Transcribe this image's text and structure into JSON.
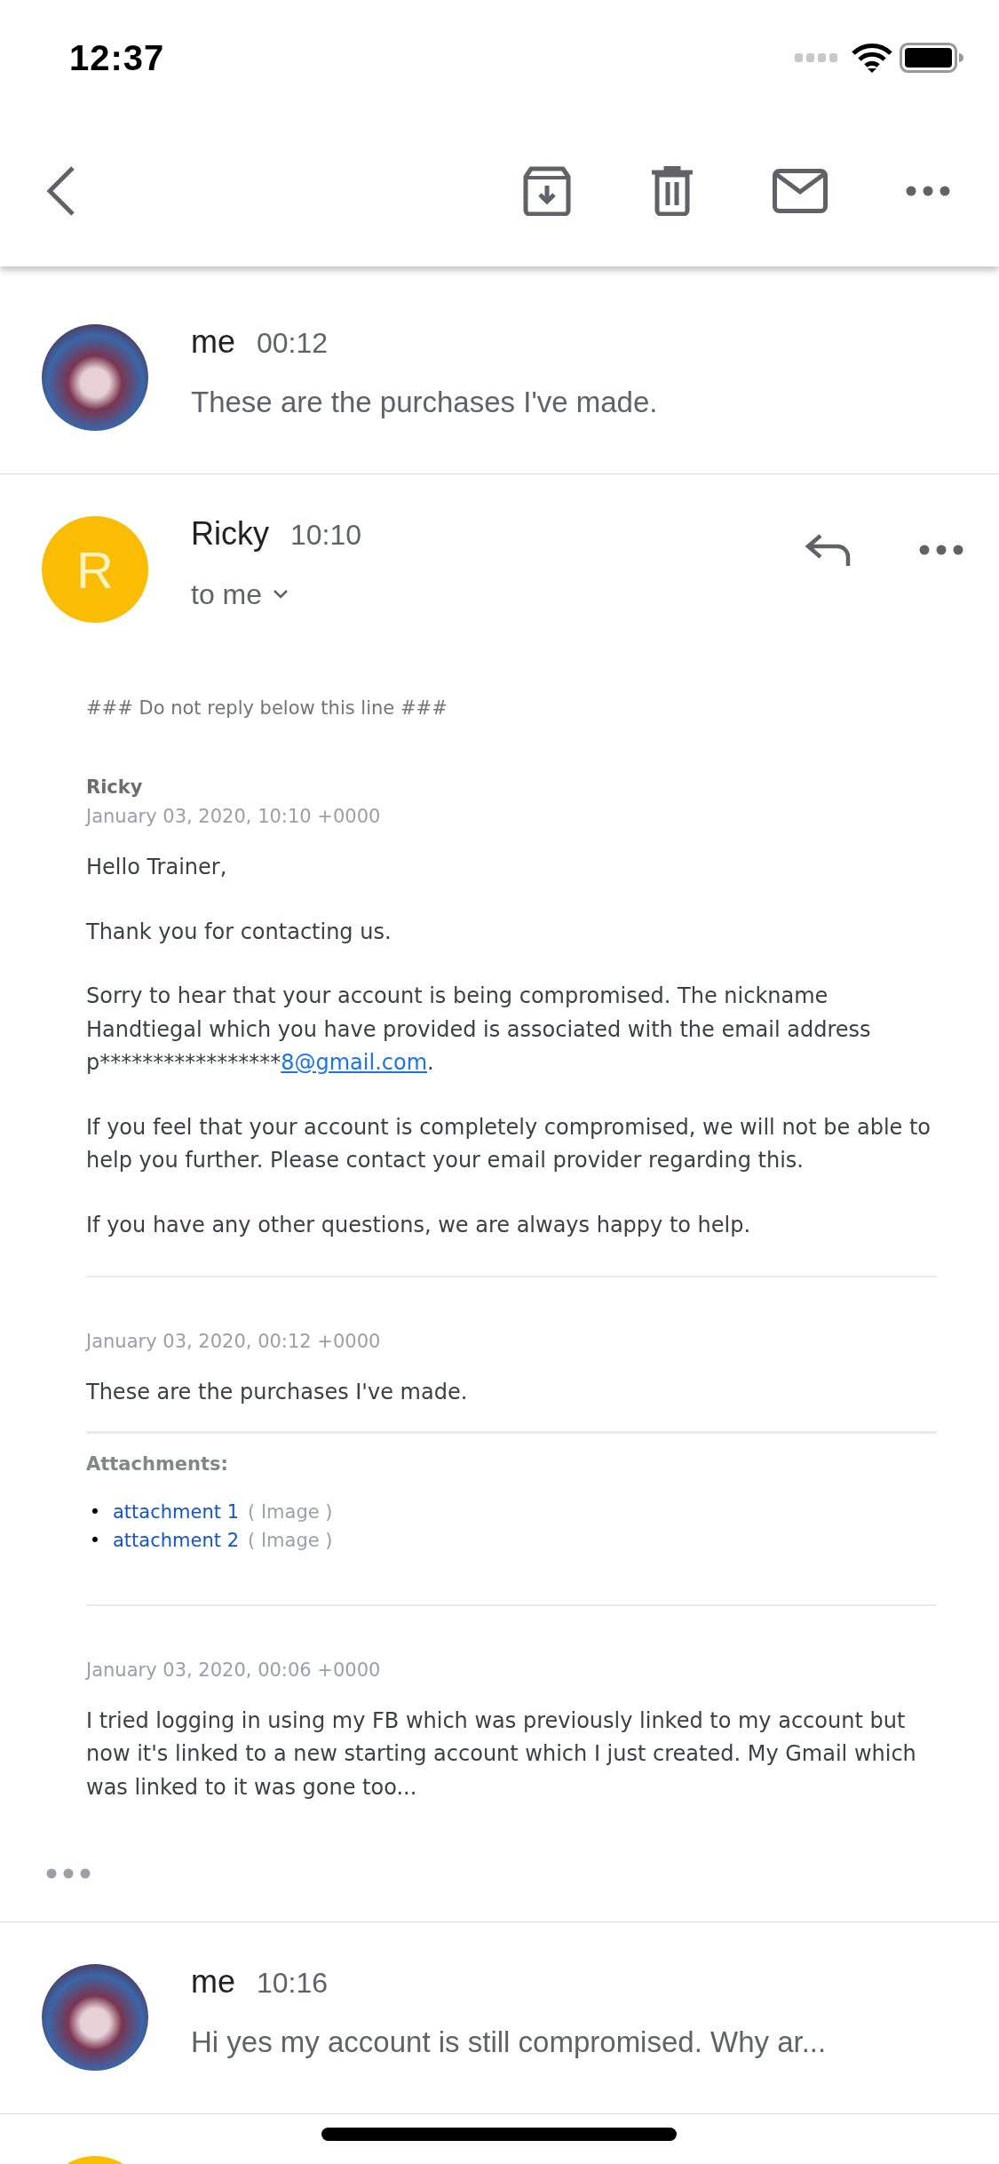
{
  "status_bar": {
    "time": "12:37"
  },
  "messages": [
    {
      "kind": "collapsed",
      "avatar": {
        "kind": "photo"
      },
      "sender": "me",
      "time": "00:12",
      "preview": "These are the purchases I've made."
    },
    {
      "kind": "expanded",
      "avatar": {
        "kind": "letter",
        "letter": "R",
        "color": "#fbbc04"
      },
      "sender": "Ricky",
      "time": "10:10",
      "recipients": "to me",
      "body": {
        "notice": "### Do not reply below this line ###",
        "entries": [
          {
            "author": "Ricky",
            "date": "January 03, 2020, 10:10 +0000",
            "paragraphs": [
              {
                "text": "Hello Trainer,"
              },
              {
                "text": "Thank you for contacting us."
              },
              {
                "text": "Sorry to hear that your account is being compromised. The nickname Handtiegal which you have provided is associated with the email address p*****************",
                "link": "8@gmail.com",
                "after": "."
              },
              {
                "text": "If you feel that your account is completely compromised, we will not be able to help you further. Please contact your email provider regarding this."
              },
              {
                "text": "If you have any other questions, we are always happy to help."
              }
            ]
          },
          {
            "date": "January 03, 2020, 00:12 +0000",
            "paragraphs": [
              {
                "text": "These are the purchases I've made."
              }
            ],
            "attachments_label": "Attachments:",
            "attachments": [
              {
                "bullet": "•",
                "name": "attachment 1",
                "type": "( Image )"
              },
              {
                "bullet": "•",
                "name": "attachment 2",
                "type": "( Image )"
              }
            ]
          },
          {
            "date": "January 03, 2020, 00:06 +0000",
            "paragraphs": [
              {
                "text": "I tried logging in using my FB which was previously linked to my account but now it's linked to a new starting account which I just created. My Gmail which was linked to it was gone too..."
              }
            ]
          }
        ]
      }
    },
    {
      "kind": "collapsed",
      "avatar": {
        "kind": "photo"
      },
      "sender": "me",
      "time": "10:16",
      "preview": "Hi yes my account is still compromised. Why ar..."
    },
    {
      "kind": "peek",
      "avatar": {
        "kind": "letter",
        "color": "#fbbc04"
      }
    }
  ]
}
